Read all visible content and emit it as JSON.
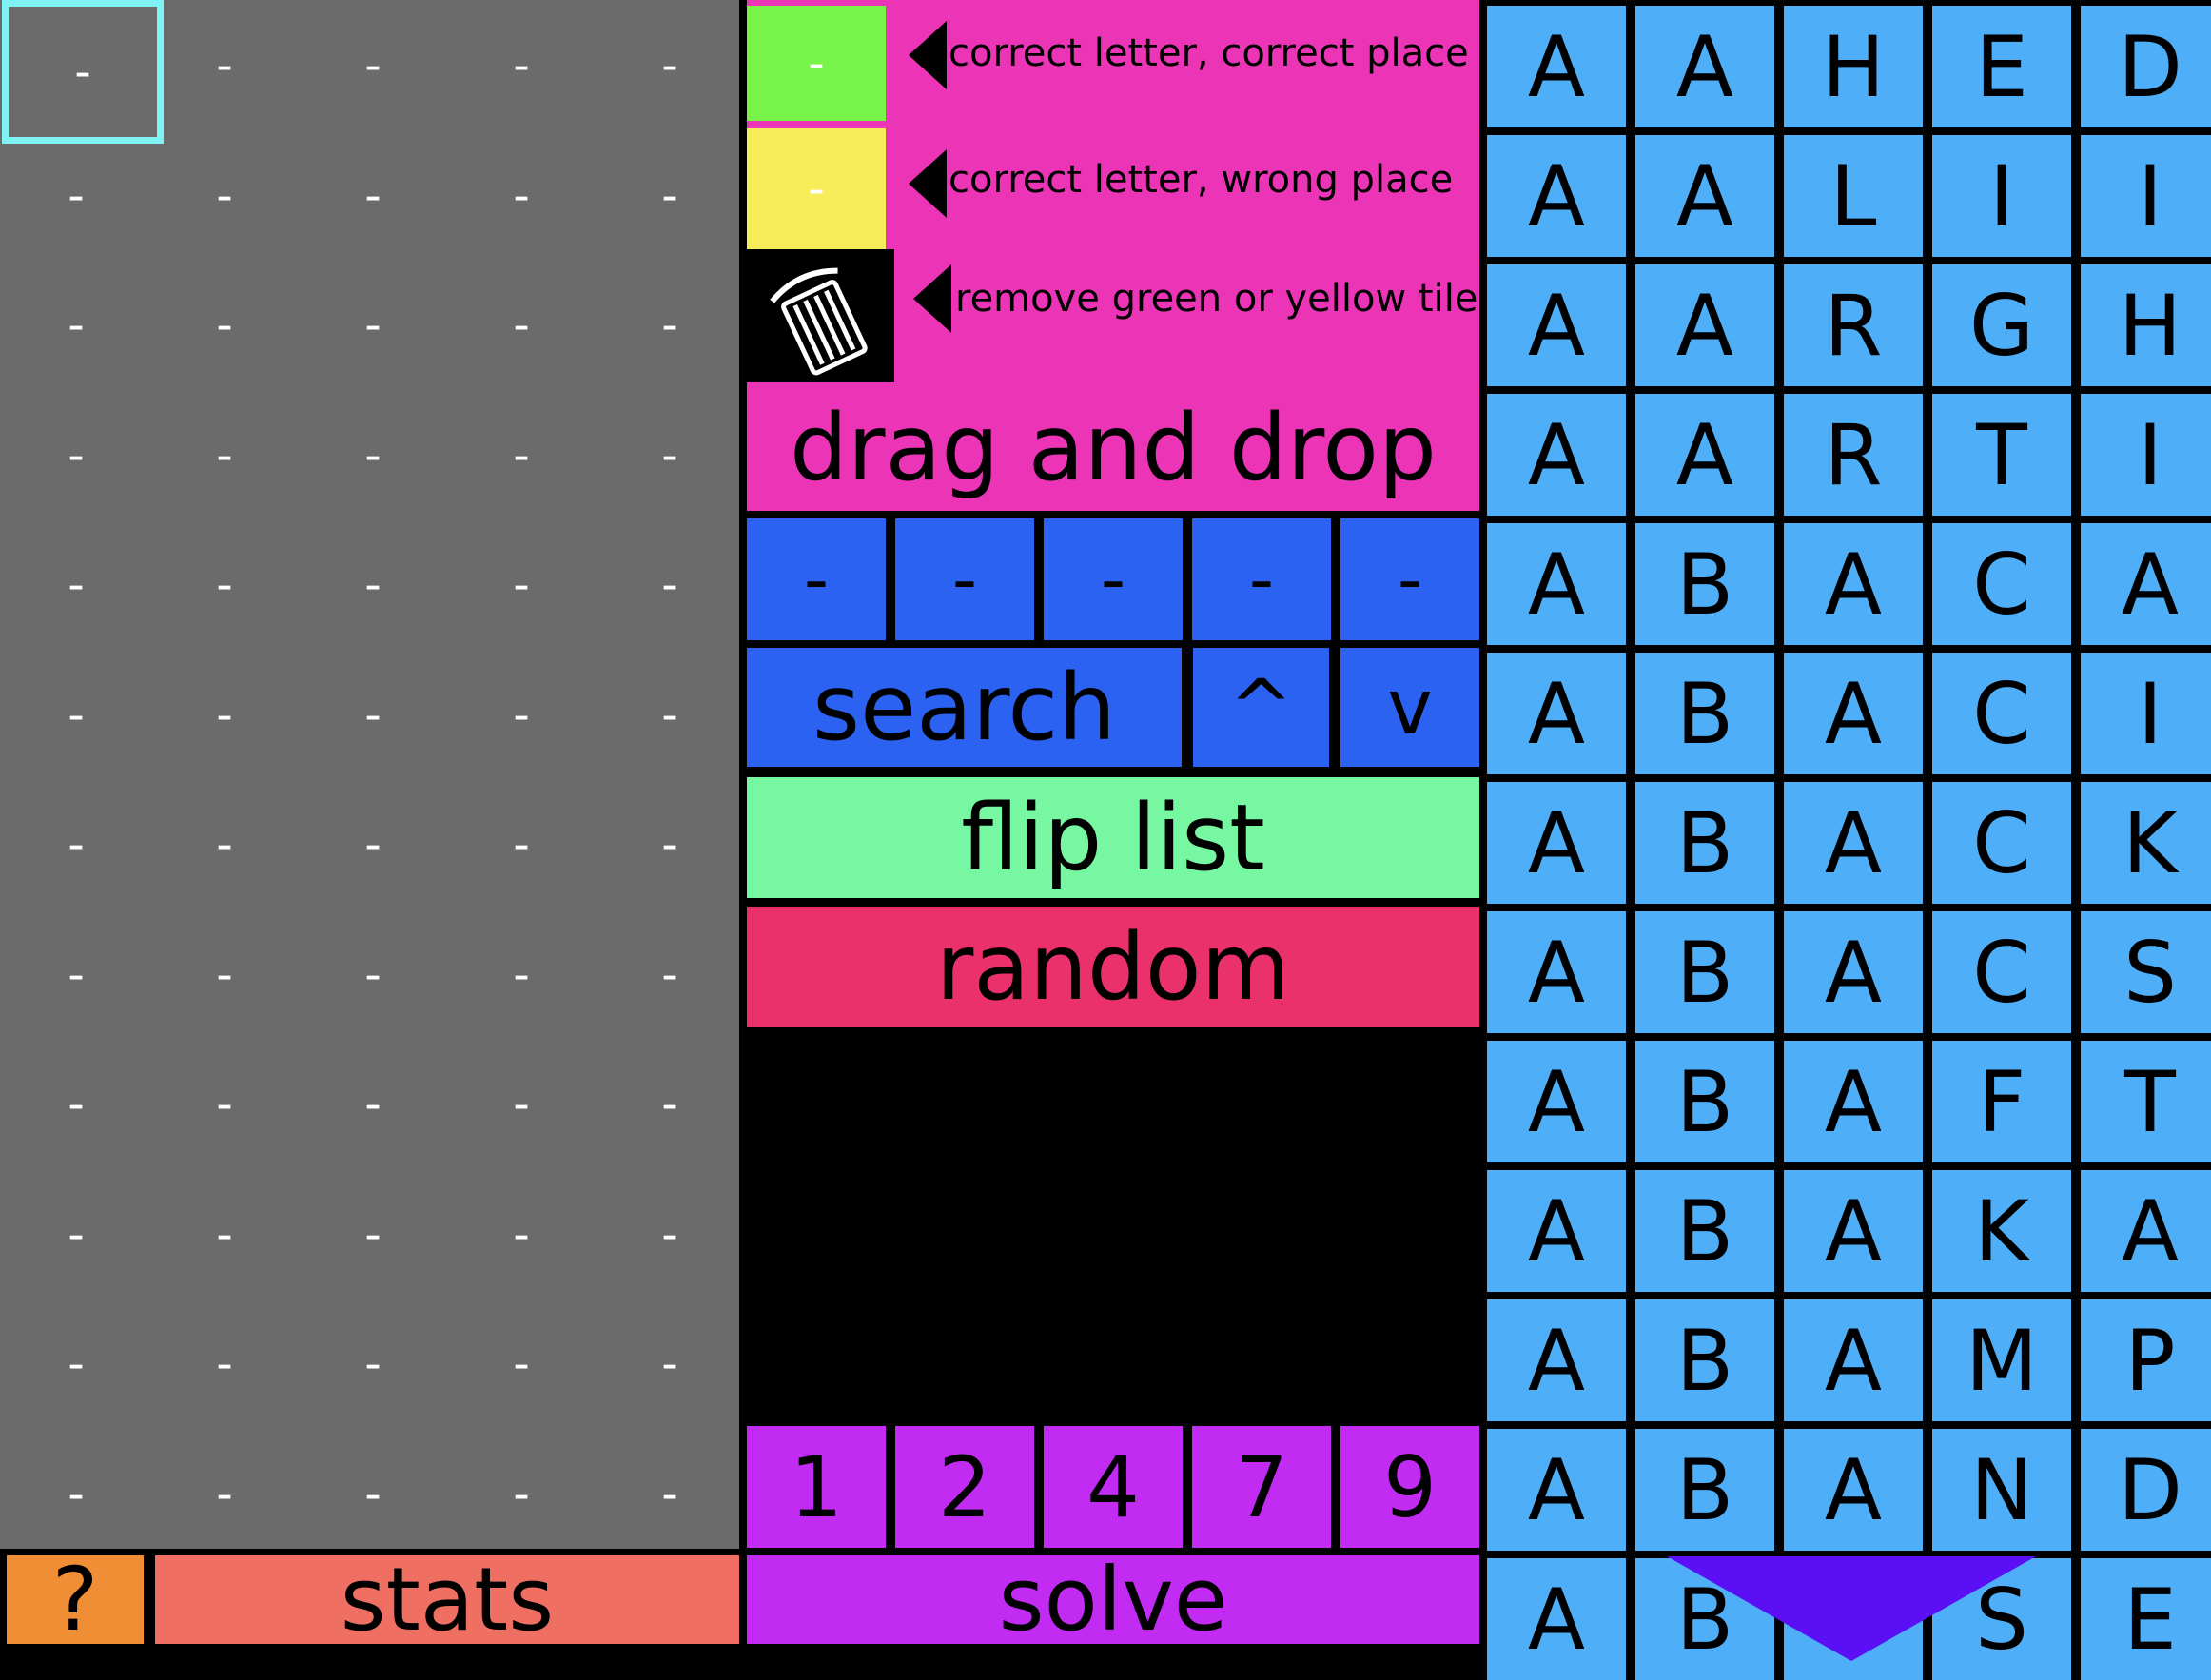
{
  "guess_grid": {
    "cells": [
      [
        "-",
        "-",
        "-",
        "-",
        "-"
      ],
      [
        "-",
        "-",
        "-",
        "-",
        "-"
      ],
      [
        "-",
        "-",
        "-",
        "-",
        "-"
      ],
      [
        "-",
        "-",
        "-",
        "-",
        "-"
      ],
      [
        "-",
        "-",
        "-",
        "-",
        "-"
      ],
      [
        "-",
        "-",
        "-",
        "-",
        "-"
      ],
      [
        "-",
        "-",
        "-",
        "-",
        "-"
      ],
      [
        "-",
        "-",
        "-",
        "-",
        "-"
      ],
      [
        "-",
        "-",
        "-",
        "-",
        "-"
      ],
      [
        "-",
        "-",
        "-",
        "-",
        "-"
      ],
      [
        "-",
        "-",
        "-",
        "-",
        "-"
      ],
      [
        "-",
        "-",
        "-",
        "-",
        "-"
      ]
    ]
  },
  "legend": {
    "green_tile": "-",
    "green_text": "correct letter, correct place",
    "yellow_tile": "-",
    "yellow_text": "correct letter, wrong place",
    "trash_text": "remove green or yellow tiles",
    "drag_drop": "drag and drop"
  },
  "input_row": [
    "-",
    "-",
    "-",
    "-",
    "-"
  ],
  "buttons": {
    "search": "search",
    "up": "^",
    "down": "v",
    "flip": "flip list",
    "random": "random",
    "help": "?",
    "stats": "stats",
    "solve": "solve"
  },
  "count_row": [
    "1",
    "2",
    "4",
    "7",
    "9"
  ],
  "word_list": [
    [
      "A",
      "A",
      "H",
      "E",
      "D"
    ],
    [
      "A",
      "A",
      "L",
      "I",
      "I"
    ],
    [
      "A",
      "A",
      "R",
      "G",
      "H"
    ],
    [
      "A",
      "A",
      "R",
      "T",
      "I"
    ],
    [
      "A",
      "B",
      "A",
      "C",
      "A"
    ],
    [
      "A",
      "B",
      "A",
      "C",
      "I"
    ],
    [
      "A",
      "B",
      "A",
      "C",
      "K"
    ],
    [
      "A",
      "B",
      "A",
      "C",
      "S"
    ],
    [
      "A",
      "B",
      "A",
      "F",
      "T"
    ],
    [
      "A",
      "B",
      "A",
      "K",
      "A"
    ],
    [
      "A",
      "B",
      "A",
      "M",
      "P"
    ],
    [
      "A",
      "B",
      "A",
      "N",
      "D"
    ],
    [
      "A",
      "B",
      "",
      "S",
      "E"
    ]
  ],
  "colors": {
    "grid_bg": "#6b6b6b",
    "green": "#77f34a",
    "yellow": "#f7ec5a",
    "pink": "#ec35b6",
    "blue": "#2b62f2",
    "word_blue": "#4eaef7",
    "purple": "#c12bf2"
  }
}
